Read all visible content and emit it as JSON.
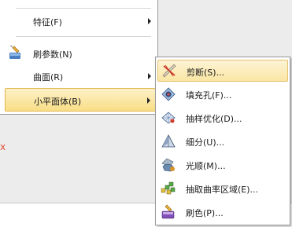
{
  "main_menu": {
    "items": [
      {
        "label": "特征(F)",
        "has_submenu": true
      },
      {
        "label": "刷参数(N)",
        "icon": "brush-params-icon",
        "has_submenu": false
      },
      {
        "label": "曲面(R)",
        "has_submenu": true
      },
      {
        "label": "小平面体(B)",
        "has_submenu": true,
        "highlighted": true
      }
    ]
  },
  "sub_menu": {
    "items": [
      {
        "label": "剪断(S)...",
        "icon": "cut-icon",
        "highlighted": true
      },
      {
        "label": "填充孔(F)...",
        "icon": "fill-hole-icon"
      },
      {
        "label": "抽样优化(D)...",
        "icon": "sampling-optimize-icon"
      },
      {
        "label": "细分(U)...",
        "icon": "subdivide-icon"
      },
      {
        "label": "光顺(M)...",
        "icon": "smooth-icon"
      },
      {
        "label": "抽取曲率区域(E)...",
        "icon": "extract-curvature-region-icon"
      },
      {
        "label": "刷色(P)...",
        "icon": "brush-color-icon"
      }
    ]
  },
  "colors": {
    "highlight": "#f9de87",
    "highlight_border": "#e2b64e",
    "menu_border": "#9a9a9a",
    "background_mark": "#e0513a"
  },
  "background": {
    "mark": "x"
  }
}
